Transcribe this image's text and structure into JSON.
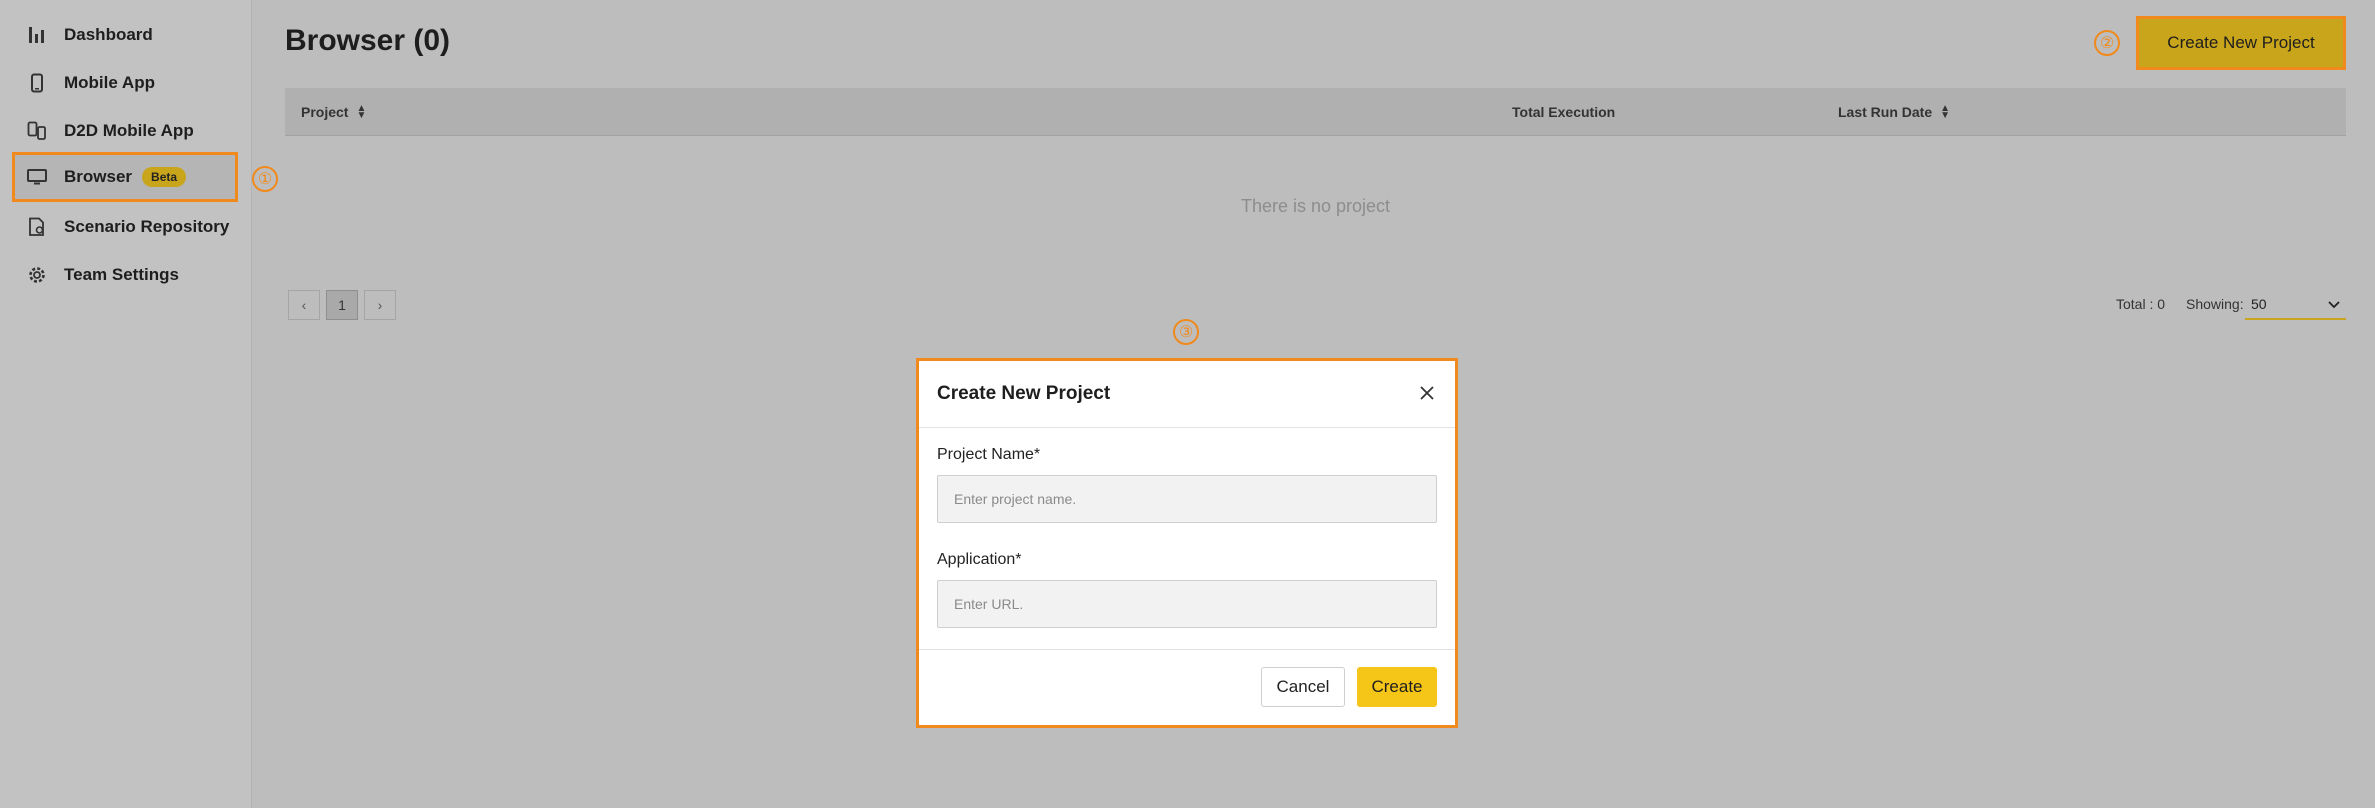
{
  "sidebar": {
    "items": [
      {
        "label": "Dashboard",
        "icon": "bar-chart-icon"
      },
      {
        "label": "Mobile App",
        "icon": "mobile-phone-icon"
      },
      {
        "label": "D2D Mobile App",
        "icon": "device-to-device-icon"
      },
      {
        "label": "Browser",
        "icon": "monitor-icon",
        "badge": "Beta",
        "active": true
      },
      {
        "label": "Scenario Repository",
        "icon": "file-settings-icon"
      },
      {
        "label": "Team Settings",
        "icon": "gear-icon"
      }
    ]
  },
  "markers": [
    "①",
    "②",
    "③"
  ],
  "header": {
    "title": "Browser (0)",
    "create_button": "Create New Project"
  },
  "table": {
    "columns": [
      "Project",
      "Total Execution",
      "Last Run Date"
    ],
    "empty_text": "There is no project"
  },
  "pagination": {
    "prev": "‹",
    "current_page": "1",
    "next": "›",
    "total_label": "Total : 0",
    "showing_label": "Showing:",
    "page_size": "50"
  },
  "modal": {
    "title": "Create New Project",
    "project_name_label": "Project Name*",
    "project_name_placeholder": "Enter project name.",
    "application_label": "Application*",
    "application_placeholder": "Enter URL.",
    "cancel_label": "Cancel",
    "create_label": "Create"
  },
  "colors": {
    "accent_yellow": "#f5c518",
    "highlight_orange": "#f08a1c",
    "overlay_gray": "#bdbdbd"
  }
}
